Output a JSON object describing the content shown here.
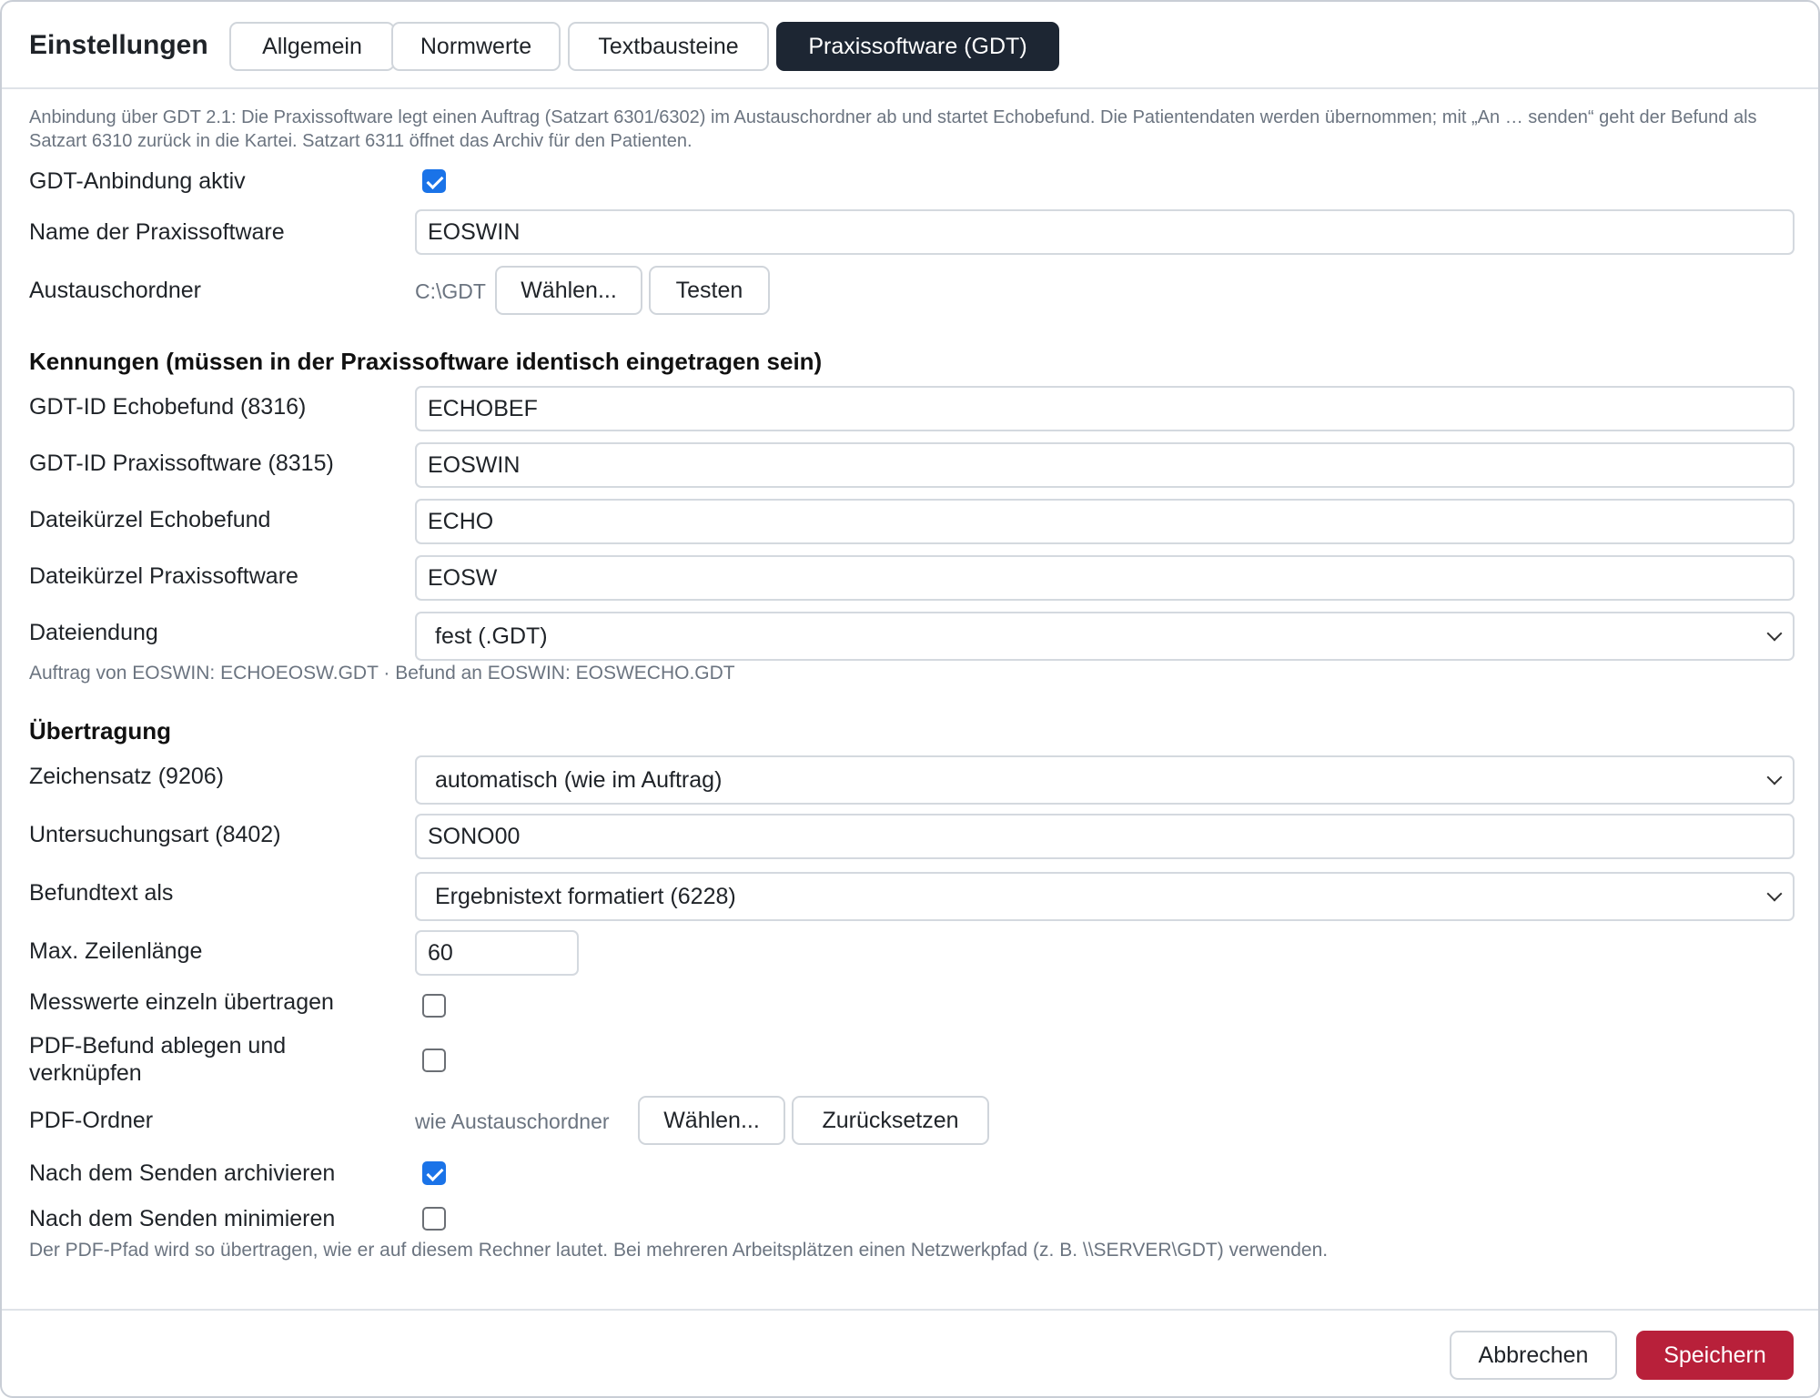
{
  "header": {
    "title": "Einstellungen",
    "tabs": [
      {
        "label": "Allgemein",
        "active": false
      },
      {
        "label": "Normwerte",
        "active": false
      },
      {
        "label": "Textbausteine",
        "active": false
      },
      {
        "label": "Praxissoftware (GDT)",
        "active": true
      }
    ]
  },
  "intro": "Anbindung über GDT 2.1: Die Praxissoftware legt einen Auftrag (Satzart 6301/6302) im Austauschordner ab und startet Echobefund. Die Patientendaten werden übernommen; mit „An … senden“ geht der Befund als Satzart 6310 zurück in die Kartei. Satzart 6311 öffnet das Archiv für den Patienten.",
  "general": {
    "gdt_active_label": "GDT-Anbindung aktiv",
    "gdt_active": true,
    "software_name_label": "Name der Praxissoftware",
    "software_name_value": "EOSWIN",
    "exchange_folder_label": "Austauschordner",
    "exchange_folder_path": "C:\\GDT",
    "choose_button": "Wählen...",
    "test_button": "Testen"
  },
  "ids": {
    "section_title": "Kennungen (müssen in der Praxissoftware identisch eingetragen sein)",
    "echobefund_id_label": "GDT-ID Echobefund (8316)",
    "echobefund_id_value": "ECHOBEF",
    "praxis_id_label": "GDT-ID Praxissoftware (8315)",
    "praxis_id_value": "EOSWIN",
    "echobefund_short_label": "Dateikürzel Echobefund",
    "echobefund_short_value": "ECHO",
    "praxis_short_label": "Dateikürzel Praxissoftware",
    "praxis_short_value": "EOSW",
    "file_ext_label": "Dateiendung",
    "file_ext_value": "fest (.GDT)",
    "file_hint": "Auftrag von EOSWIN: ECHOEOSW.GDT · Befund an EOSWIN: EOSWECHO.GDT"
  },
  "transfer": {
    "section_title": "Übertragung",
    "charset_label": "Zeichensatz (9206)",
    "charset_value": "automatisch (wie im Auftrag)",
    "exam_type_label": "Untersuchungsart (8402)",
    "exam_type_value": "SONO00",
    "report_text_label": "Befundtext als",
    "report_text_value": "Ergebnistext formatiert (6228)",
    "max_line_label": "Max. Zeilenlänge",
    "max_line_value": "60",
    "single_values_label": "Messwerte einzeln übertragen",
    "single_values": false,
    "pdf_store_label_1": "PDF-Befund ablegen und",
    "pdf_store_label_2": "verknüpfen",
    "pdf_store": false,
    "pdf_folder_label": "PDF-Ordner",
    "pdf_folder_value": "wie Austauschordner",
    "pdf_choose_button": "Wählen...",
    "pdf_reset_button": "Zurücksetzen",
    "archive_label": "Nach dem Senden archivieren",
    "archive": true,
    "minimize_label": "Nach dem Senden minimieren",
    "minimize": false,
    "pdf_hint": "Der PDF-Pfad wird so übertragen, wie er auf diesem Rechner lautet. Bei mehreren Arbeitsplätzen einen Netzwerkpfad (z. B. \\\\SERVER\\GDT) verwenden."
  },
  "footer": {
    "cancel_button": "Abbrechen",
    "save_button": "Speichern"
  },
  "colors": {
    "active_tab": "#1d2633",
    "primary_button": "#b8203a",
    "checkbox_on": "#1a73e8"
  }
}
